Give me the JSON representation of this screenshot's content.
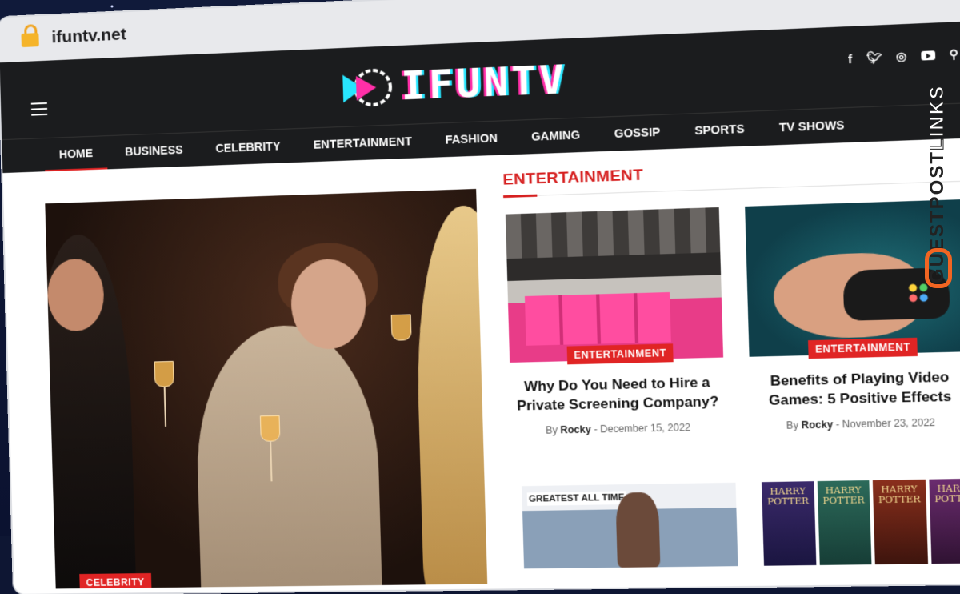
{
  "browser": {
    "url": "ifuntv.net"
  },
  "site": {
    "logo_text": "IFUNTV",
    "social_icons": [
      "facebook-icon",
      "twitter-icon",
      "instagram-icon",
      "youtube-icon",
      "search-icon"
    ],
    "nav": [
      "HOME",
      "BUSINESS",
      "CELEBRITY",
      "ENTERTAINMENT",
      "FASHION",
      "GAMING",
      "GOSSIP",
      "SPORTS",
      "TV SHOWS"
    ],
    "active_nav": "HOME",
    "accent": "#e02424"
  },
  "hero": {
    "badge": "CELEBRITY"
  },
  "section": {
    "title": "ENTERTAINMENT"
  },
  "cards": [
    {
      "badge": "ENTERTAINMENT",
      "title": "Why Do You Need to Hire a Private Screening Company?",
      "by": "By",
      "author": "Rocky",
      "sep": "-",
      "date": "December 15, 2022"
    },
    {
      "badge": "ENTERTAINMENT",
      "title": "Benefits of Playing Video Games: 5 Positive Effects",
      "by": "By",
      "author": "Rocky",
      "sep": "-",
      "date": "November 23, 2022"
    }
  ],
  "thumb_sign": "GREATEST ALL TIME",
  "books": [
    {
      "line1": "HARRY",
      "line2": "POTTER"
    },
    {
      "line1": "HARRY",
      "line2": "POTTER"
    },
    {
      "line1": "HARRY",
      "line2": "POTTER"
    },
    {
      "line1": "HARRY",
      "line2": "POTTER"
    }
  ],
  "watermark": {
    "text_a": "GUESTPOST",
    "text_b": "LINKS"
  }
}
